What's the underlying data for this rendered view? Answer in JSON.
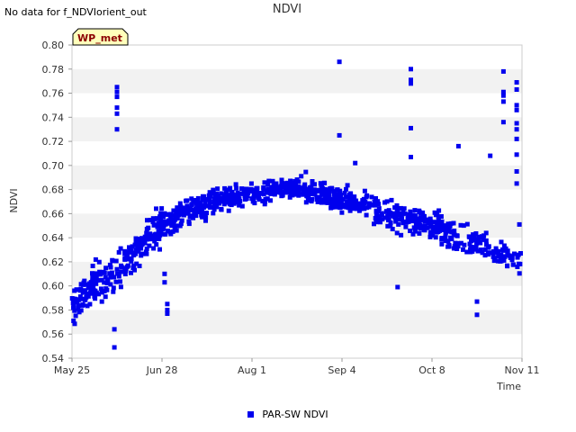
{
  "no_data_note": "No data for f_NDVIorient_out",
  "colors": {
    "series": "#0000ee",
    "band": "#f2f2f2",
    "badge_bg": "#ffffbb",
    "badge_text": "#8b0000"
  },
  "chart_data": {
    "type": "scatter",
    "title": "NDVI",
    "xlabel": "Time",
    "ylabel": "NDVI",
    "x_ticks": [
      "May 25",
      "Jun 28",
      "Aug 1",
      "Sep 4",
      "Oct 8",
      "Nov 11"
    ],
    "y_ticks": [
      "0.54",
      "0.56",
      "0.58",
      "0.60",
      "0.62",
      "0.64",
      "0.66",
      "0.68",
      "0.70",
      "0.72",
      "0.74",
      "0.76",
      "0.78",
      "0.80"
    ],
    "xlim": [
      "May 25",
      "Nov 11"
    ],
    "ylim": [
      0.54,
      0.8
    ],
    "badge": "WP_met",
    "legend": {
      "position": "bottom",
      "label": "PAR-SW NDVI"
    },
    "series": [
      {
        "name": "PAR-SW NDVI",
        "segments": [
          {
            "from": "May 25",
            "to": "Jun 12",
            "start": 0.585,
            "end": 0.615,
            "spread": 0.028,
            "count": 110
          },
          {
            "from": "Jun 12",
            "to": "Jun 28",
            "start": 0.615,
            "end": 0.65,
            "spread": 0.026,
            "count": 120
          },
          {
            "from": "Jun 28",
            "to": "Jul 18",
            "start": 0.65,
            "end": 0.672,
            "spread": 0.02,
            "count": 150
          },
          {
            "from": "Jul 18",
            "to": "Aug 20",
            "start": 0.672,
            "end": 0.682,
            "spread": 0.014,
            "count": 230
          },
          {
            "from": "Aug 20",
            "to": "Sep 12",
            "start": 0.682,
            "end": 0.665,
            "spread": 0.016,
            "count": 180
          },
          {
            "from": "Sep 12",
            "to": "Oct 8",
            "start": 0.665,
            "end": 0.65,
            "spread": 0.02,
            "count": 150
          },
          {
            "from": "Oct 8",
            "to": "Oct 25",
            "start": 0.65,
            "end": 0.635,
            "spread": 0.022,
            "count": 100
          },
          {
            "from": "Oct 25",
            "to": "Nov 11",
            "start": 0.635,
            "end": 0.618,
            "spread": 0.02,
            "count": 70
          }
        ],
        "outliers": [
          {
            "x": "Jun 11",
            "y": 0.765
          },
          {
            "x": "Jun 11",
            "y": 0.761
          },
          {
            "x": "Jun 11",
            "y": 0.757
          },
          {
            "x": "Jun 11",
            "y": 0.748
          },
          {
            "x": "Jun 11",
            "y": 0.743
          },
          {
            "x": "Jun 11",
            "y": 0.73
          },
          {
            "x": "Jun 10",
            "y": 0.549
          },
          {
            "x": "Jun 10",
            "y": 0.564
          },
          {
            "x": "Sep 3",
            "y": 0.786
          },
          {
            "x": "Sep 3",
            "y": 0.725
          },
          {
            "x": "Sep 30",
            "y": 0.78
          },
          {
            "x": "Sep 30",
            "y": 0.771
          },
          {
            "x": "Sep 30",
            "y": 0.768
          },
          {
            "x": "Sep 30",
            "y": 0.731
          },
          {
            "x": "Sep 30",
            "y": 0.707
          },
          {
            "x": "Sep 9",
            "y": 0.702
          },
          {
            "x": "Sep 25",
            "y": 0.599
          },
          {
            "x": "Oct 18",
            "y": 0.716
          },
          {
            "x": "Oct 30",
            "y": 0.708
          },
          {
            "x": "Nov 4",
            "y": 0.778
          },
          {
            "x": "Nov 4",
            "y": 0.761
          },
          {
            "x": "Nov 4",
            "y": 0.758
          },
          {
            "x": "Nov 4",
            "y": 0.753
          },
          {
            "x": "Nov 4",
            "y": 0.736
          },
          {
            "x": "Nov 9",
            "y": 0.769
          },
          {
            "x": "Nov 9",
            "y": 0.763
          },
          {
            "x": "Nov 9",
            "y": 0.75
          },
          {
            "x": "Nov 9",
            "y": 0.746
          },
          {
            "x": "Nov 9",
            "y": 0.735
          },
          {
            "x": "Nov 9",
            "y": 0.73
          },
          {
            "x": "Nov 9",
            "y": 0.722
          },
          {
            "x": "Nov 9",
            "y": 0.709
          },
          {
            "x": "Nov 9",
            "y": 0.695
          },
          {
            "x": "Nov 9",
            "y": 0.685
          },
          {
            "x": "Nov 10",
            "y": 0.651
          },
          {
            "x": "Jun 30",
            "y": 0.585
          },
          {
            "x": "Jun 30",
            "y": 0.58
          },
          {
            "x": "Jun 30",
            "y": 0.577
          },
          {
            "x": "Jun 29",
            "y": 0.61
          },
          {
            "x": "Jun 29",
            "y": 0.603
          },
          {
            "x": "Oct 25",
            "y": 0.576
          },
          {
            "x": "Oct 25",
            "y": 0.587
          }
        ]
      }
    ]
  }
}
